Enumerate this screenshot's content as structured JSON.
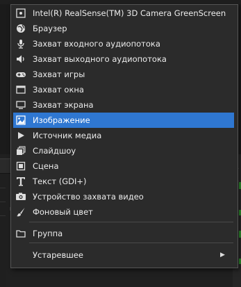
{
  "background": {
    "left_label": "и"
  },
  "menu": {
    "items": [
      {
        "label": "Intel(R) RealSense(TM) 3D Camera GreenScreen",
        "icon": "realsense-icon"
      },
      {
        "label": "Браузер",
        "icon": "globe-icon"
      },
      {
        "label": "Захват входного аудиопотока",
        "icon": "microphone-icon"
      },
      {
        "label": "Захват выходного аудиопотока",
        "icon": "speaker-icon"
      },
      {
        "label": "Захват игры",
        "icon": "gamepad-icon"
      },
      {
        "label": "Захват окна",
        "icon": "window-icon"
      },
      {
        "label": "Захват экрана",
        "icon": "monitor-icon"
      },
      {
        "label": "Изображение",
        "icon": "image-icon",
        "selected": true
      },
      {
        "label": "Источник медиа",
        "icon": "play-icon"
      },
      {
        "label": "Слайдшоу",
        "icon": "slideshow-icon"
      },
      {
        "label": "Сцена",
        "icon": "scene-icon"
      },
      {
        "label": "Текст (GDI+)",
        "icon": "text-icon"
      },
      {
        "label": "Устройство захвата видео",
        "icon": "camera-icon"
      },
      {
        "label": "Фоновый цвет",
        "icon": "brush-icon"
      },
      {
        "label": "Группа",
        "icon": "folder-icon"
      },
      {
        "label": "Устаревшее",
        "icon": "",
        "submenu": true
      }
    ]
  },
  "colors": {
    "menu_bg": "#2b2b2b",
    "selected_bg": "#2f77d1",
    "text": "#ececec"
  }
}
